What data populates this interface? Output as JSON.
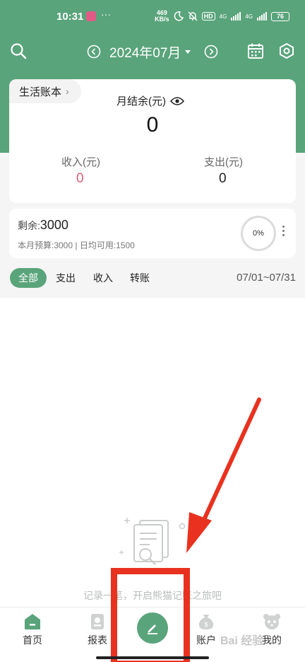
{
  "status_bar": {
    "time": "10:31",
    "dots": "···",
    "net_speed_top": "469",
    "net_speed_bottom": "KB/s",
    "hd": "HD",
    "net1": "4G",
    "net2": "4G",
    "battery": "76"
  },
  "header": {
    "month": "2024年07月"
  },
  "summary": {
    "book_name": "生活账本",
    "balance_label": "月结余(元)",
    "balance_value": "0",
    "income_label": "收入(元)",
    "income_value": "0",
    "expense_label": "支出(元)",
    "expense_value": "0"
  },
  "budget": {
    "remain_label": "剩余:",
    "remain_value": "3000",
    "detail": "本月预算:3000 | 日均可用:1500",
    "progress_text": "0%",
    "progress": 0
  },
  "filters": {
    "tabs": [
      "全部",
      "支出",
      "收入",
      "转账"
    ],
    "selected": "全部",
    "date_range": "07/01~07/31"
  },
  "empty_state": {
    "text": "记录一笔，开启熊猫记账之旅吧"
  },
  "bottom_nav": {
    "items": [
      {
        "label": "首页",
        "icon": "home-icon"
      },
      {
        "label": "报表",
        "icon": "report-icon"
      },
      {
        "label": "账户",
        "icon": "money-bag-icon"
      },
      {
        "label": "我的",
        "icon": "panda-icon"
      }
    ],
    "fab_icon": "pencil-icon"
  },
  "watermark": "Bai 经验",
  "colors": {
    "primary": "#5aa47b",
    "income": "#d9607a",
    "annotation": "#e8321f"
  }
}
